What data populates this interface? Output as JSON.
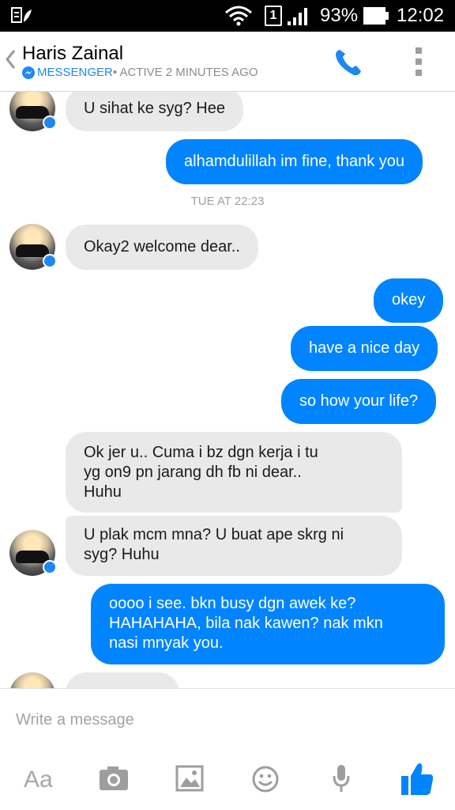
{
  "status": {
    "battery_pct": "93%",
    "time": "12:02",
    "sim": "1"
  },
  "header": {
    "title": "Haris Zainal",
    "app": "MESSENGER",
    "status": " • ACTIVE 2 MINUTES AGO"
  },
  "messages": [
    {
      "dir": "in",
      "text": "U sihat ke syg? Hee"
    },
    {
      "dir": "out",
      "text": "alhamdulillah im fine, thank you"
    },
    {
      "dir": "timestamp",
      "text": "TUE AT 22:23"
    },
    {
      "dir": "in",
      "text": "Okay2 welcome dear.."
    },
    {
      "dir": "out",
      "text": "okey"
    },
    {
      "dir": "out",
      "text": "have a nice day"
    },
    {
      "dir": "out",
      "text": "so how your life?"
    },
    {
      "dir": "in",
      "lines": [
        "Ok jer u.. Cuma i bz dgn kerja i tu",
        "yg on9 pn jarang dh fb ni dear..",
        "Huhu"
      ]
    },
    {
      "dir": "in",
      "lines": [
        "U plak mcm mna? U buat ape skrg ni",
        "syg? Huhu"
      ]
    },
    {
      "dir": "out",
      "lines": [
        "oooo i see. bkn busy dgn awek ke?",
        "HAHAHAHA, bila nak kawen? nak mkn",
        "nasi mnyak you."
      ]
    }
  ],
  "composer": {
    "placeholder": "Write a message",
    "aa_label": "Aa"
  },
  "icons": {
    "back": "chevron-left-icon",
    "call": "phone-icon",
    "menu": "more-vertical-icon",
    "camera": "camera-icon",
    "gallery": "image-icon",
    "emoji": "smiley-icon",
    "mic": "microphone-icon",
    "like": "thumbs-up-icon"
  },
  "colors": {
    "accent": "#0084ff",
    "incoming_bubble": "#e9e9e9",
    "icon_grey": "#9e9e9e"
  }
}
